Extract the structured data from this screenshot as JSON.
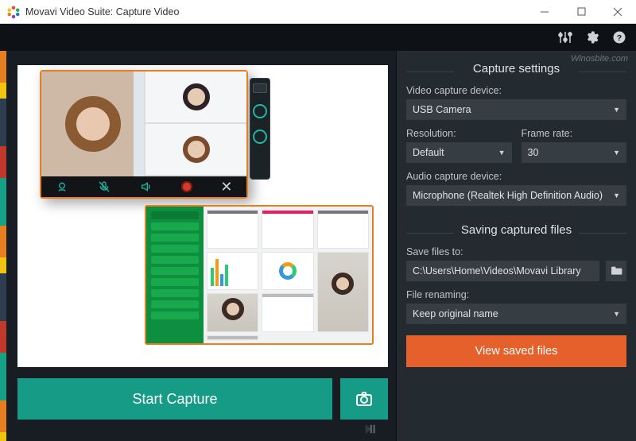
{
  "window": {
    "title": "Movavi Video Suite: Capture Video",
    "watermark": "Winosbite.com"
  },
  "leftPanel": {
    "startCapture": "Start Capture"
  },
  "settings": {
    "headerCapture": "Capture settings",
    "videoDeviceLabel": "Video capture device:",
    "videoDeviceValue": "USB Camera",
    "resolutionLabel": "Resolution:",
    "resolutionValue": "Default",
    "frameRateLabel": "Frame rate:",
    "frameRateValue": "30",
    "audioDeviceLabel": "Audio capture device:",
    "audioDeviceValue": "Microphone (Realtek High Definition Audio)",
    "headerSaving": "Saving captured files",
    "saveToLabel": "Save files to:",
    "saveToPath": "C:\\Users\\Home\\Videos\\Movavi Library",
    "renamingLabel": "File renaming:",
    "renamingValue": "Keep original name",
    "viewSaved": "View saved files"
  }
}
